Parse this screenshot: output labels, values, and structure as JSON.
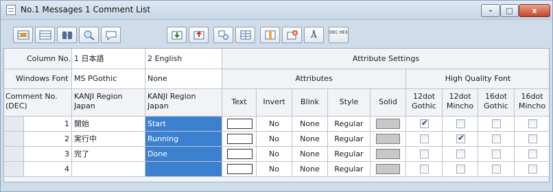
{
  "window": {
    "title": "No.1 Messages 1 Comment List"
  },
  "controls": {
    "minimize": "-",
    "maximize": "□",
    "close": "x"
  },
  "toolbar": {
    "buttons": [
      {
        "name": "insert-row-button"
      },
      {
        "name": "delete-row-button"
      },
      {
        "name": "column-width-button"
      },
      {
        "name": "find-button"
      },
      {
        "name": "comment-button"
      },
      {
        "name": "import-button"
      },
      {
        "name": "export-button"
      },
      {
        "name": "replace-button"
      },
      {
        "name": "grid-button"
      },
      {
        "name": "column-setting-button"
      },
      {
        "name": "add-button"
      },
      {
        "name": "font-setting-button",
        "label": "Å"
      },
      {
        "name": "dec-hex-button",
        "label": "DEC HEX"
      }
    ]
  },
  "grid": {
    "column_no_label": "Column No.",
    "col1": "1 日本語",
    "col2": "2 English",
    "attribute_settings": "Attribute Settings",
    "windows_font_label": "Windows Font",
    "font1": "MS PGothic",
    "font2": "None",
    "attributes": "Attributes",
    "hq_font": "High Quality Font",
    "comment_no": "Comment No.\n(DEC)",
    "kanji1": "KANJI Region\nJapan",
    "kanji2": "KANJI Region\nJapan",
    "text": "Text",
    "invert": "Invert",
    "blink": "Blink",
    "style": "Style",
    "solid": "Solid",
    "g12": "12dot\nGothic",
    "m12": "12dot\nMincho",
    "g16": "16dot\nGothic",
    "m16": "16dot\nMincho",
    "rows": [
      {
        "no": "1",
        "jp": "開始",
        "en": "Start",
        "invert": "No",
        "blink": "None",
        "style": "Regular",
        "checks": [
          true,
          false,
          false,
          false
        ]
      },
      {
        "no": "2",
        "jp": "実行中",
        "en": "Running",
        "invert": "No",
        "blink": "None",
        "style": "Regular",
        "checks": [
          false,
          true,
          false,
          false
        ]
      },
      {
        "no": "3",
        "jp": "完了",
        "en": "Done",
        "invert": "No",
        "blink": "None",
        "style": "Regular",
        "checks": [
          false,
          false,
          false,
          false
        ]
      },
      {
        "no": "4",
        "jp": "",
        "en": "",
        "invert": "No",
        "blink": "None",
        "style": "Regular",
        "checks": [
          false,
          false,
          false,
          false
        ]
      }
    ]
  }
}
